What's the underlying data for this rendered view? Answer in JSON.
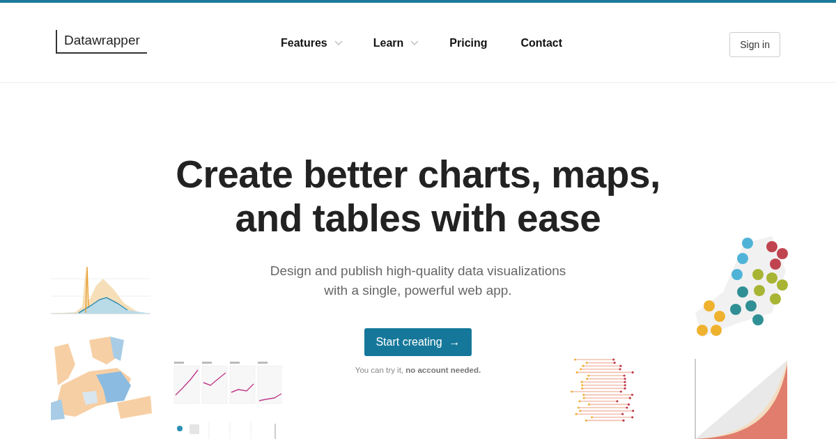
{
  "header": {
    "logo": "Datawrapper",
    "nav": [
      {
        "label": "Features",
        "dropdown": true
      },
      {
        "label": "Learn",
        "dropdown": true
      },
      {
        "label": "Pricing",
        "dropdown": false
      },
      {
        "label": "Contact",
        "dropdown": false
      }
    ],
    "sign_in": "Sign in"
  },
  "hero": {
    "title_lines": [
      "Create better charts, maps,",
      "and tables with ease"
    ],
    "subtitle_lines": [
      "Design and publish high-quality data visualizations",
      "with a single, powerful web app."
    ],
    "cta": {
      "label": "Start creating",
      "arrow": "→"
    },
    "note": "You can try it, **no account needed.**"
  },
  "showcase": [
    {
      "kind": "area"
    },
    {
      "kind": "map"
    },
    {
      "kind": "multiples"
    },
    {
      "kind": "strip"
    },
    {
      "kind": "dots"
    },
    {
      "kind": "bubbles"
    },
    {
      "kind": "lorenz"
    }
  ]
}
